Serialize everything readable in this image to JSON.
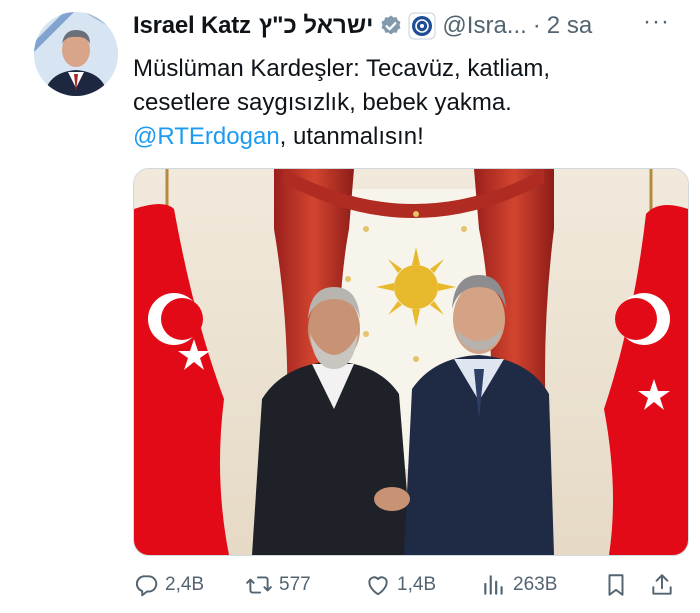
{
  "tweet": {
    "author_name": "Israel Katz",
    "author_name_hebrew": "ישראל כ\"ץ",
    "handle": "@Isra...",
    "separator": "·",
    "time": "2 sa",
    "text_line1": "Müslüman Kardeşler: Tecavüz, katliam,",
    "text_line2": "cesetlere saygısızlık, bebek yakma.",
    "mention": "@RTErdogan",
    "text_after_mention": ", utanmalısın!",
    "more_label": "···"
  },
  "actions": {
    "replies": "2,4B",
    "reposts": "577",
    "likes": "1,4B",
    "views": "263B"
  },
  "colors": {
    "accent": "#1d9bf0",
    "verified": "#829aab",
    "text": "#0f1419",
    "muted": "#536471",
    "flag_red": "#e30a17"
  },
  "icons": [
    "verified-badge-icon",
    "org-badge-icon",
    "more-icon",
    "reply-icon",
    "repost-icon",
    "like-icon",
    "views-icon",
    "bookmark-icon",
    "share-icon"
  ]
}
